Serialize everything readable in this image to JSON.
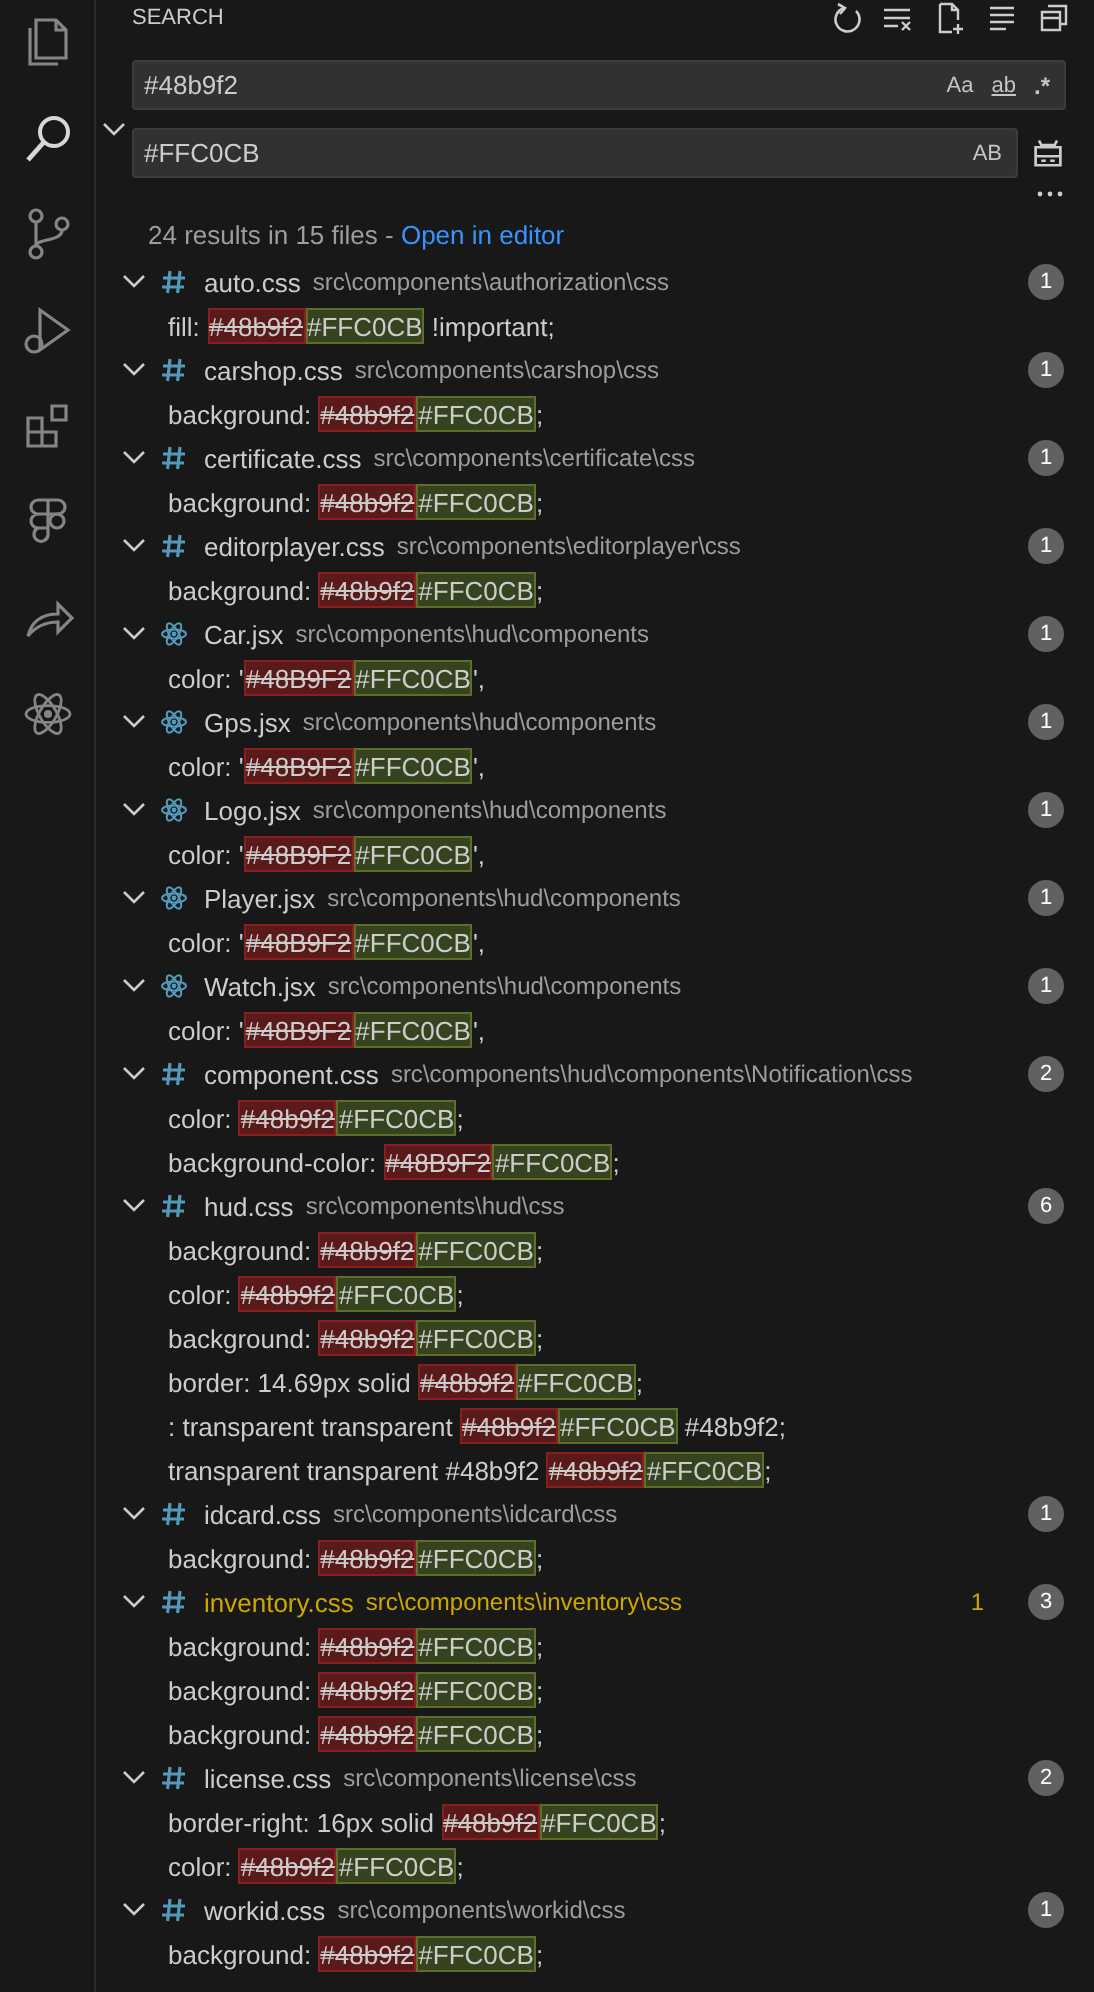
{
  "activity_bar": [
    {
      "kind": "explorer",
      "selected": false
    },
    {
      "kind": "search",
      "selected": true
    },
    {
      "kind": "source-control",
      "selected": false
    },
    {
      "kind": "run-debug",
      "selected": false
    },
    {
      "kind": "extensions",
      "selected": false
    },
    {
      "kind": "figma",
      "selected": false
    },
    {
      "kind": "share",
      "selected": false
    },
    {
      "kind": "react",
      "selected": false
    }
  ],
  "panel": {
    "title": "SEARCH"
  },
  "replace_expanded": true,
  "search": {
    "value": "#48b9f2",
    "toggles": [
      {
        "label": "Aa",
        "selected": false
      },
      {
        "label": "ab",
        "selected": false
      },
      {
        "label": ".*",
        "selected": false
      }
    ]
  },
  "replace": {
    "value": "#FFC0CB",
    "toggles": [
      {
        "label": "AB",
        "selected": false
      }
    ]
  },
  "summary": {
    "text": "24 results in 15 files - ",
    "link": "Open in editor"
  },
  "results": [
    {
      "kind": "css",
      "name": "auto.css",
      "path": "src\\components\\authorization\\css",
      "count": "1",
      "warning": false,
      "expanded": true,
      "matches": [
        {
          "before": "fill: ",
          "old": "#48b9f2",
          "new": "#FFC0CB",
          "after": " !important;"
        }
      ]
    },
    {
      "kind": "css",
      "name": "carshop.css",
      "path": "src\\components\\carshop\\css",
      "count": "1",
      "warning": false,
      "expanded": true,
      "matches": [
        {
          "before": "background: ",
          "old": "#48b9f2",
          "new": "#FFC0CB",
          "after": ";"
        }
      ]
    },
    {
      "kind": "css",
      "name": "certificate.css",
      "path": "src\\components\\certificate\\css",
      "count": "1",
      "warning": false,
      "expanded": true,
      "matches": [
        {
          "before": "background: ",
          "old": "#48b9f2",
          "new": "#FFC0CB",
          "after": ";"
        }
      ]
    },
    {
      "kind": "css",
      "name": "editorplayer.css",
      "path": "src\\components\\editorplayer\\css",
      "count": "1",
      "warning": false,
      "expanded": true,
      "matches": [
        {
          "before": "background: ",
          "old": "#48b9f2",
          "new": "#FFC0CB",
          "after": ";"
        }
      ]
    },
    {
      "kind": "jsx",
      "name": "Car.jsx",
      "path": "src\\components\\hud\\components",
      "count": "1",
      "warning": false,
      "expanded": true,
      "matches": [
        {
          "before": "color: '",
          "old": "#48B9F2",
          "new": "#FFC0CB",
          "after": "',"
        }
      ]
    },
    {
      "kind": "jsx",
      "name": "Gps.jsx",
      "path": "src\\components\\hud\\components",
      "count": "1",
      "warning": false,
      "expanded": true,
      "matches": [
        {
          "before": "color: '",
          "old": "#48B9F2",
          "new": "#FFC0CB",
          "after": "',"
        }
      ]
    },
    {
      "kind": "jsx",
      "name": "Logo.jsx",
      "path": "src\\components\\hud\\components",
      "count": "1",
      "warning": false,
      "expanded": true,
      "matches": [
        {
          "before": "color: '",
          "old": "#48B9F2",
          "new": "#FFC0CB",
          "after": "',"
        }
      ]
    },
    {
      "kind": "jsx",
      "name": "Player.jsx",
      "path": "src\\components\\hud\\components",
      "count": "1",
      "warning": false,
      "expanded": true,
      "matches": [
        {
          "before": "color: '",
          "old": "#48B9F2",
          "new": "#FFC0CB",
          "after": "',"
        }
      ]
    },
    {
      "kind": "jsx",
      "name": "Watch.jsx",
      "path": "src\\components\\hud\\components",
      "count": "1",
      "warning": false,
      "expanded": true,
      "matches": [
        {
          "before": "color: '",
          "old": "#48B9F2",
          "new": "#FFC0CB",
          "after": "',"
        }
      ]
    },
    {
      "kind": "css",
      "name": "component.css",
      "path": "src\\components\\hud\\components\\Notification\\css",
      "count": "2",
      "warning": false,
      "expanded": true,
      "matches": [
        {
          "before": "color: ",
          "old": "#48b9f2",
          "new": "#FFC0CB",
          "after": ";"
        },
        {
          "before": "background-color: ",
          "old": "#48B9F2",
          "new": "#FFC0CB",
          "after": ";"
        }
      ]
    },
    {
      "kind": "css",
      "name": "hud.css",
      "path": "src\\components\\hud\\css",
      "count": "6",
      "warning": false,
      "expanded": true,
      "matches": [
        {
          "before": "background: ",
          "old": "#48b9f2",
          "new": "#FFC0CB",
          "after": ";"
        },
        {
          "before": "color: ",
          "old": "#48b9f2",
          "new": "#FFC0CB",
          "after": ";"
        },
        {
          "before": "background: ",
          "old": "#48b9f2",
          "new": "#FFC0CB",
          "after": ";"
        },
        {
          "before": "border: 14.69px solid ",
          "old": "#48b9f2",
          "new": "#FFC0CB",
          "after": ";"
        },
        {
          "before": ": transparent transparent ",
          "old": "#48b9f2",
          "new": "#FFC0CB",
          "after": " #48b9f2;"
        },
        {
          "before": "transparent transparent #48b9f2 ",
          "old": "#48b9f2",
          "new": "#FFC0CB",
          "after": ";"
        }
      ]
    },
    {
      "kind": "css",
      "name": "idcard.css",
      "path": "src\\components\\idcard\\css",
      "count": "1",
      "warning": false,
      "expanded": true,
      "matches": [
        {
          "before": "background: ",
          "old": "#48b9f2",
          "new": "#FFC0CB",
          "after": ";"
        }
      ]
    },
    {
      "kind": "css",
      "name": "inventory.css",
      "path": "src\\components\\inventory\\css",
      "count": "3",
      "warning": true,
      "problems": "1",
      "expanded": true,
      "matches": [
        {
          "before": "background: ",
          "old": "#48b9f2",
          "new": "#FFC0CB",
          "after": ";"
        },
        {
          "before": "background: ",
          "old": "#48b9f2",
          "new": "#FFC0CB",
          "after": ";"
        },
        {
          "before": "background: ",
          "old": "#48b9f2",
          "new": "#FFC0CB",
          "after": ";"
        }
      ]
    },
    {
      "kind": "css",
      "name": "license.css",
      "path": "src\\components\\license\\css",
      "count": "2",
      "warning": false,
      "expanded": true,
      "matches": [
        {
          "before": "border-right: 16px solid ",
          "old": "#48b9f2",
          "new": "#FFC0CB",
          "after": ";"
        },
        {
          "before": "color: ",
          "old": "#48b9f2",
          "new": "#FFC0CB",
          "after": ";"
        }
      ]
    },
    {
      "kind": "css",
      "name": "workid.css",
      "path": "src\\components\\workid\\css",
      "count": "1",
      "warning": false,
      "expanded": true,
      "matches": [
        {
          "before": "background: ",
          "old": "#48b9f2",
          "new": "#FFC0CB",
          "after": ";"
        }
      ]
    }
  ]
}
